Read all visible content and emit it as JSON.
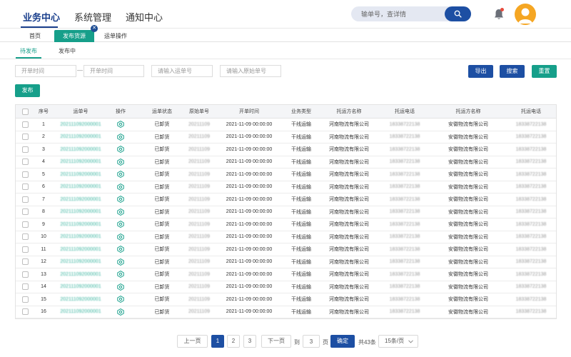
{
  "nav": {
    "items": [
      "业务中心",
      "系统管理",
      "通知中心"
    ],
    "search_placeholder": "输单号，查详情",
    "icons": {
      "search": "search-icon",
      "bell": "bell-icon",
      "avatar": "user-avatar-icon"
    },
    "colors": {
      "primary": "#1d4fa3",
      "accent": "#169f8a",
      "avatar": "#f5a623",
      "badge": "#e84a3c"
    }
  },
  "tabs": [
    "首页",
    "发布货源",
    "运单操作"
  ],
  "subtabs": [
    "待发布",
    "发布中"
  ],
  "filters": {
    "start_time_placeholder": "开单时间",
    "end_time_placeholder": "开单时间",
    "waybill_placeholder": "请输入运单号",
    "original_placeholder": "请输入原始单号",
    "range_separator": "—"
  },
  "buttons": {
    "export": "导出",
    "search": "搜索",
    "reset": "重置",
    "publish": "发布"
  },
  "table": {
    "columns": [
      "序号",
      "运单号",
      "操作",
      "运单状态",
      "原始单号",
      "开单时间",
      "业务类型",
      "托运方名称",
      "托运电话",
      "托运方名称",
      "托运电话"
    ],
    "rows": [
      {
        "no": "1",
        "waybill": "202111092000001",
        "status": "已卸货",
        "original": "20211109",
        "time": "2021-11-09 00:00:00",
        "type": "干线运输",
        "shipper": "河南物流有限公司",
        "shipper_phone": "18338722138",
        "consignee": "安徽物流有限公司",
        "consignee_phone": "18338722138"
      },
      {
        "no": "2",
        "waybill": "202111092000001",
        "status": "已卸货",
        "original": "20211109",
        "time": "2021-11-09 00:00:00",
        "type": "干线运输",
        "shipper": "河南物流有限公司",
        "shipper_phone": "18338722138",
        "consignee": "安徽物流有限公司",
        "consignee_phone": "18338722138"
      },
      {
        "no": "3",
        "waybill": "202111092000001",
        "status": "已卸货",
        "original": "20211109",
        "time": "2021-11-09 00:00:00",
        "type": "干线运输",
        "shipper": "河南物流有限公司",
        "shipper_phone": "18338722138",
        "consignee": "安徽物流有限公司",
        "consignee_phone": "18338722138"
      },
      {
        "no": "4",
        "waybill": "202111092000001",
        "status": "已卸货",
        "original": "20211109",
        "time": "2021-11-09 00:00:00",
        "type": "干线运输",
        "shipper": "河南物流有限公司",
        "shipper_phone": "18338722138",
        "consignee": "安徽物流有限公司",
        "consignee_phone": "18338722138"
      },
      {
        "no": "5",
        "waybill": "202111092000001",
        "status": "已卸货",
        "original": "20211109",
        "time": "2021-11-09 00:00:00",
        "type": "干线运输",
        "shipper": "河南物流有限公司",
        "shipper_phone": "18338722138",
        "consignee": "安徽物流有限公司",
        "consignee_phone": "18338722138"
      },
      {
        "no": "6",
        "waybill": "202111092000001",
        "status": "已卸货",
        "original": "20211109",
        "time": "2021-11-09 00:00:00",
        "type": "干线运输",
        "shipper": "河南物流有限公司",
        "shipper_phone": "18338722138",
        "consignee": "安徽物流有限公司",
        "consignee_phone": "18338722138"
      },
      {
        "no": "7",
        "waybill": "202111092000001",
        "status": "已卸货",
        "original": "20211109",
        "time": "2021-11-09 00:00:00",
        "type": "干线运输",
        "shipper": "河南物流有限公司",
        "shipper_phone": "18338722138",
        "consignee": "安徽物流有限公司",
        "consignee_phone": "18338722138"
      },
      {
        "no": "8",
        "waybill": "202111092000001",
        "status": "已卸货",
        "original": "20211109",
        "time": "2021-11-09 00:00:00",
        "type": "干线运输",
        "shipper": "河南物流有限公司",
        "shipper_phone": "18338722138",
        "consignee": "安徽物流有限公司",
        "consignee_phone": "18338722138"
      },
      {
        "no": "9",
        "waybill": "202111092000001",
        "status": "已卸货",
        "original": "20211109",
        "time": "2021-11-09 00:00:00",
        "type": "干线运输",
        "shipper": "河南物流有限公司",
        "shipper_phone": "18338722138",
        "consignee": "安徽物流有限公司",
        "consignee_phone": "18338722138"
      },
      {
        "no": "10",
        "waybill": "202111092000001",
        "status": "已卸货",
        "original": "20211109",
        "time": "2021-11-09 00:00:00",
        "type": "干线运输",
        "shipper": "河南物流有限公司",
        "shipper_phone": "18338722138",
        "consignee": "安徽物流有限公司",
        "consignee_phone": "18338722138"
      },
      {
        "no": "11",
        "waybill": "202111092000001",
        "status": "已卸货",
        "original": "20211109",
        "time": "2021-11-09 00:00:00",
        "type": "干线运输",
        "shipper": "河南物流有限公司",
        "shipper_phone": "18338722138",
        "consignee": "安徽物流有限公司",
        "consignee_phone": "18338722138"
      },
      {
        "no": "12",
        "waybill": "202111092000001",
        "status": "已卸货",
        "original": "20211109",
        "time": "2021-11-09 00:00:00",
        "type": "干线运输",
        "shipper": "河南物流有限公司",
        "shipper_phone": "18338722138",
        "consignee": "安徽物流有限公司",
        "consignee_phone": "18338722138"
      },
      {
        "no": "13",
        "waybill": "202111092000001",
        "status": "已卸货",
        "original": "20211109",
        "time": "2021-11-09 00:00:00",
        "type": "干线运输",
        "shipper": "河南物流有限公司",
        "shipper_phone": "18338722138",
        "consignee": "安徽物流有限公司",
        "consignee_phone": "18338722138"
      },
      {
        "no": "14",
        "waybill": "202111092000001",
        "status": "已卸货",
        "original": "20211109",
        "time": "2021-11-09 00:00:00",
        "type": "干线运输",
        "shipper": "河南物流有限公司",
        "shipper_phone": "18338722138",
        "consignee": "安徽物流有限公司",
        "consignee_phone": "18338722138"
      },
      {
        "no": "15",
        "waybill": "202111092000001",
        "status": "已卸货",
        "original": "20211109",
        "time": "2021-11-09 00:00:00",
        "type": "干线运输",
        "shipper": "河南物流有限公司",
        "shipper_phone": "18338722138",
        "consignee": "安徽物流有限公司",
        "consignee_phone": "18338722138"
      },
      {
        "no": "16",
        "waybill": "202111092000001",
        "status": "已卸货",
        "original": "20211109",
        "time": "2021-11-09 00:00:00",
        "type": "干线运输",
        "shipper": "河南物流有限公司",
        "shipper_phone": "18338722138",
        "consignee": "安徽物流有限公司",
        "consignee_phone": "18338722138"
      }
    ]
  },
  "pagination": {
    "prev": "上一页",
    "pages": [
      "1",
      "2",
      "3"
    ],
    "current": "1",
    "next": "下一页",
    "goto_label": "到",
    "goto_value": "3",
    "page_unit": "页",
    "confirm": "确定",
    "total": "共43条",
    "page_size": "15条/页"
  }
}
